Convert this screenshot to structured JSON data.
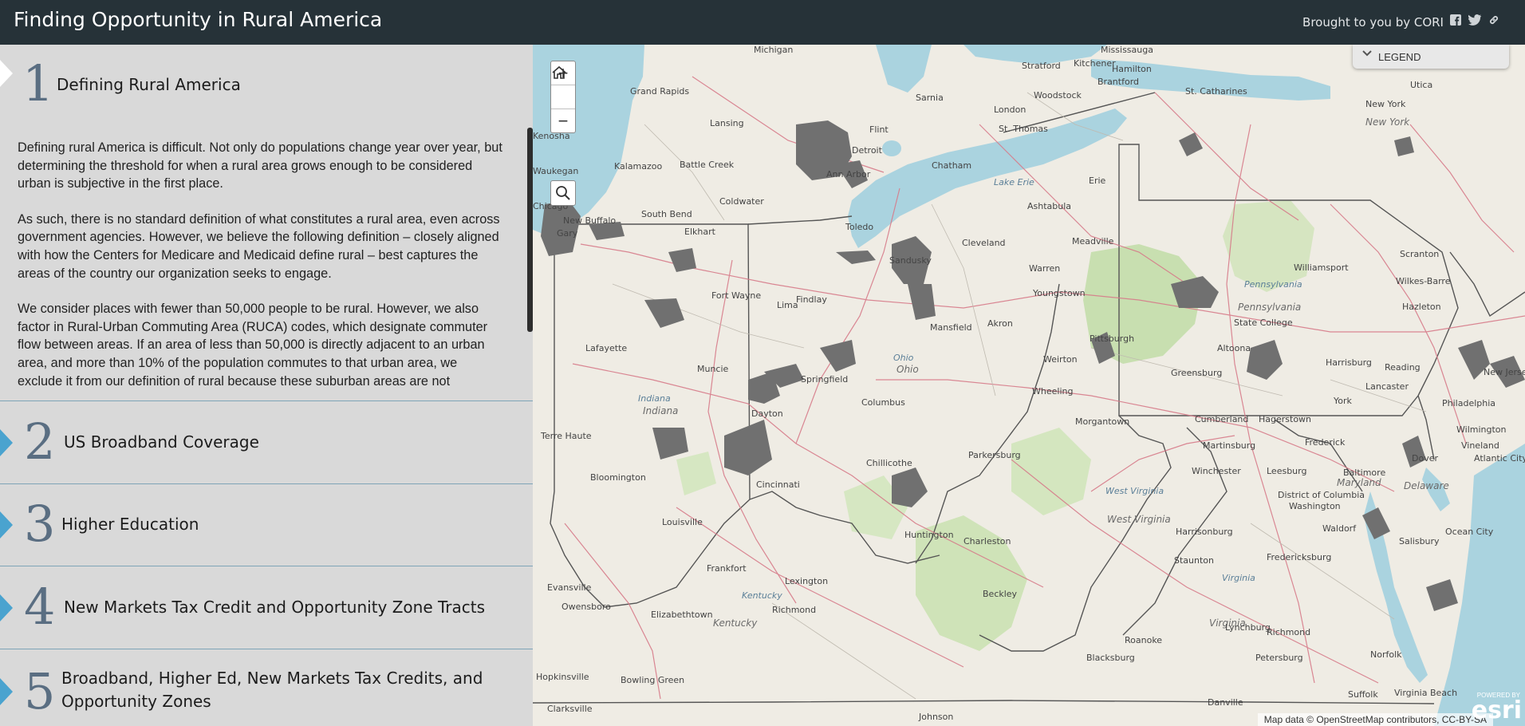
{
  "header": {
    "title": "Finding Opportunity in Rural America",
    "byline": "Brought to you by CORI",
    "social_icons": [
      "facebook-icon",
      "twitter-icon",
      "link-icon"
    ]
  },
  "sections": [
    {
      "number": "1",
      "title": "Defining Rural America",
      "active": true
    },
    {
      "number": "2",
      "title": "US Broadband Coverage"
    },
    {
      "number": "3",
      "title": "Higher Education"
    },
    {
      "number": "4",
      "title": "New Markets Tax Credit and Opportunity Zone Tracts"
    },
    {
      "number": "5",
      "title_line1": "Broadband, Higher Ed, New Markets Tax Credits, and",
      "title_line2": "Opportunity Zones"
    }
  ],
  "section1_body": [
    "Defining rural America is difficult. Not only do populations change year over year, but determining the threshold for when a rural area grows enough to be considered urban is subjective in the first place.",
    "As such, there is no standard definition of what constitutes a rural area, even across government agencies. However, we believe the following definition – closely aligned with how the Centers for Medicare and Medicaid define rural – best captures the areas of the country our organization seeks to engage.",
    "We consider places with fewer than 50,000 people to be rural. However, we also factor in Rural-Urban Commuting Area (RUCA) codes, which designate commuter flow between areas. If an area of less than 50,000 is directly adjacent to an urban area, and more than 10% of the population commutes to that urban area, we exclude it from our definition of rural because these suburban areas are not"
  ],
  "map": {
    "zoom_in": "+",
    "zoom_out": "−",
    "legend_label": "LEGEND",
    "attribution": "Map data © OpenStreetMap contributors, CC-BY-SA",
    "esri_powered": "POWERED BY",
    "esri": "esri",
    "labels": {
      "michigan": "Michigan",
      "mississauga": "Mississauga",
      "hamilton": "Hamilton",
      "stratford": "Stratford",
      "kitchener": "Kitchener",
      "brantford": "Brantford",
      "woodstock": "Woodstock",
      "london": "London",
      "st_thomas": "St. Thomas",
      "chatham": "Chatham",
      "sarnia": "Sarnia",
      "st_catharines": "St. Catharines",
      "utica": "Utica",
      "new_york_city": "New York",
      "new_york_state": "New York",
      "lake_erie": "Lake Erie",
      "erie": "Erie",
      "ashtabula": "Ashtabula",
      "cleveland": "Cleveland",
      "sandusky": "Sandusky",
      "findlay": "Findlay",
      "mansfield": "Mansfield",
      "warren": "Warren",
      "youngstown": "Youngstown",
      "akron": "Akron",
      "meadville": "Meadville",
      "williamsport": "Williamsport",
      "scranton": "Scranton",
      "wilkes_barre": "Wilkes-Barre",
      "hazleton": "Hazleton",
      "pennsylvania_water": "Pennsylvania",
      "pennsylvania": "Pennsylvania",
      "state_college": "State College",
      "altoona": "Altoona",
      "harrisburg": "Harrisburg",
      "reading": "Reading",
      "lancaster": "Lancaster",
      "york": "York",
      "philadelphia": "Philadelphia",
      "greensburg": "Greensburg",
      "weirton": "Weirton",
      "wheeling": "Wheeling",
      "morgantown": "Morgantown",
      "cumberland": "Cumberland",
      "hagerstown": "Hagerstown",
      "frederick": "Frederick",
      "martinsburg": "Martinsburg",
      "winchester": "Winchester",
      "leesburg": "Leesburg",
      "baltimore": "Baltimore",
      "maryland": "Maryland",
      "district_of_columbia": "District of Columbia",
      "washington": "Washington",
      "waldorf": "Waldorf",
      "dover": "Dover",
      "delaware": "Delaware",
      "vineland": "Vineland",
      "atlantic_city": "Atlantic City",
      "salisbury": "Salisbury",
      "ocean_city": "Ocean City",
      "fredericksburg": "Fredericksburg",
      "harrisonburg": "Harrisonburg",
      "staunton": "Staunton",
      "virginia_water": "Virginia",
      "virginia": "Virginia",
      "lynchburg": "Lynchburg",
      "richmond_va": "Richmond",
      "petersburg": "Petersburg",
      "norfolk": "Norfolk",
      "suffolk": "Suffolk",
      "virginia_beach": "Virginia Beach",
      "danville": "Danville",
      "roanoke": "Roanoke",
      "blacksburg": "Blacksburg",
      "west_virginia_water": "West Virginia",
      "west_virginia": "West Virginia",
      "charleston": "Charleston",
      "huntington": "Huntington",
      "beckley": "Beckley",
      "parkersburg": "Parkersburg",
      "chillicothe": "Chillicothe",
      "columbus": "Columbus",
      "ohio_water": "Ohio",
      "ohio": "Ohio",
      "springfield": "Springfield",
      "dayton": "Dayton",
      "cincinnati": "Cincinnati",
      "lima": "Lima",
      "fort_wayne": "Fort Wayne",
      "muncie": "Muncie",
      "indiana_water": "Indiana",
      "indiana": "Indiana",
      "lafayette": "Lafayette",
      "terre_haute": "Terre Haute",
      "bloomington": "Bloomington",
      "louisville": "Louisville",
      "frankfort": "Frankfort",
      "lexington": "Lexington",
      "richmond_ky": "Richmond",
      "kentucky_water": "Kentucky",
      "kentucky": "Kentucky",
      "elizabethtown": "Elizabethtown",
      "owensboro": "Owensboro",
      "evansville": "Evansville",
      "hopkinsville": "Hopkinsville",
      "bowling_green": "Bowling Green",
      "clarksville": "Clarksville",
      "johnson": "Johnson",
      "new_buffalo": "New Buffalo",
      "south_bend": "South Bend",
      "elkhart": "Elkhart",
      "chicago": "Chicago",
      "gary": "Gary",
      "kalamazoo": "Kalamazoo",
      "battle_creek": "Battle Creek",
      "coldwater": "Coldwater",
      "ann_arbor": "Ann Arbor",
      "detroit": "Detroit",
      "lansing": "Lansing",
      "grand_rapids": "Grand Rapids",
      "flint": "Flint",
      "toledo": "Toledo",
      "kenosha": "Kenosha",
      "waukegan": "Waukegan",
      "wilmington": "Wilmington",
      "new_jersey": "New Jersey",
      "pittsburgh": "Pittsburgh"
    }
  },
  "colors": {
    "header_bg": "#263238",
    "panel_bg": "#d9d9d9",
    "accent_arrow": "#4aa3cf",
    "number": "#5a6e82",
    "water": "#aad3df",
    "land": "#efece4",
    "urban": "#6f6f6f"
  }
}
